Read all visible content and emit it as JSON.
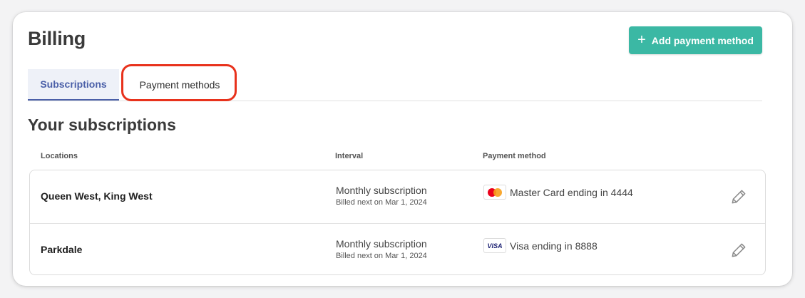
{
  "header": {
    "title": "Billing",
    "add_button_label": "Add payment method",
    "add_button_icon": "plus-icon"
  },
  "tabs": [
    {
      "label": "Subscriptions",
      "active": true
    },
    {
      "label": "Payment methods",
      "active": false
    }
  ],
  "section_title": "Your subscriptions",
  "columns": [
    "Locations",
    "Interval",
    "Payment method"
  ],
  "rows": [
    {
      "location": "Queen West, King West",
      "interval": "Monthly subscription",
      "billing_note": "Billed next on Mar 1, 2024",
      "card_brand": "mastercard",
      "payment": "Master Card ending in 4444"
    },
    {
      "location": "Parkdale",
      "interval": "Monthly subscription",
      "billing_note": "Billed next on Mar 1, 2024",
      "card_brand": "VISA",
      "payment": "Visa ending in 8888"
    }
  ],
  "colors": {
    "accent": "#3bb8a4",
    "tab_active": "#4a5fa8",
    "highlight": "#e8321c"
  }
}
